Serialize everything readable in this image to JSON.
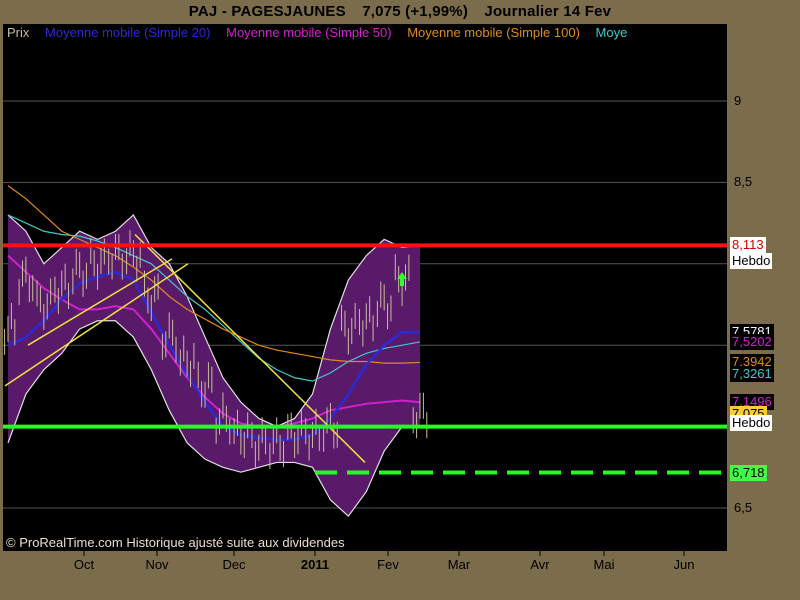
{
  "title": {
    "symbol": "PAJ - PAGESJAUNES",
    "price": "7,075 (+1,99%)",
    "period": "Journalier  14 Fev"
  },
  "legend": [
    {
      "label": "Prix",
      "color": "#c9bda0"
    },
    {
      "label": "Moyenne mobile (Simple 20)",
      "color": "#2a2ad8"
    },
    {
      "label": "Moyenne mobile (Simple 50)",
      "color": "#d020d0"
    },
    {
      "label": "Moyenne mobile (Simple 100)",
      "color": "#e08a20"
    },
    {
      "label": "Moye",
      "color": "#40c8c8"
    }
  ],
  "footer": "© ProRealTime.com Historique ajusté suite aux dividendes",
  "price_tags": [
    {
      "text": "8,113",
      "sub": "Hebdo",
      "bg": "#ffffff",
      "fg": "#d00000",
      "value": 8.113
    },
    {
      "text": "7,5781",
      "bg": "#000000",
      "fg": "#ffffff",
      "value": 7.5781
    },
    {
      "text": "7,5202",
      "bg": "#000000",
      "fg": "#d020d0",
      "value": 7.5202,
      "partial": true
    },
    {
      "text": "7,3942",
      "bg": "#000000",
      "fg": "#e08a20",
      "value": 7.3942,
      "partial": true
    },
    {
      "text": "7,3261",
      "bg": "#000000",
      "fg": "#40c8c8",
      "value": 7.3261
    },
    {
      "text": "7,1496",
      "bg": "#000000",
      "fg": "#d020d0",
      "value": 7.1496,
      "partial": true
    },
    {
      "text": "7,075",
      "bg": "#ffcc33",
      "fg": "#000000",
      "value": 7.075
    },
    {
      "text": "Hebdo",
      "bg": "#ffffff",
      "fg": "#000000",
      "value": 7.02
    },
    {
      "text": "6,718",
      "bg": "#40ff40",
      "fg": "#000000",
      "value": 6.718
    }
  ],
  "chart_data": {
    "type": "line",
    "title": "PAJ - PAGESJAUNES",
    "y_axis": {
      "ticks": [
        "9",
        "8,5",
        "8",
        "7,5",
        "7",
        "6,5"
      ],
      "range": [
        6.25,
        9.45
      ]
    },
    "x_axis": {
      "ticks": [
        "Oct",
        "Nov",
        "Dec",
        "2011",
        "Fev",
        "Mar",
        "Avr",
        "Mai",
        "Jun"
      ]
    },
    "horizontal_lines": [
      {
        "name": "resistance",
        "value": 8.113,
        "color": "#ff1010",
        "style": "solid"
      },
      {
        "name": "support",
        "value": 7.0,
        "color": "#20ff20",
        "style": "solid"
      },
      {
        "name": "support-dashed",
        "value": 6.718,
        "color": "#20ff20",
        "style": "dashed"
      }
    ],
    "series": [
      {
        "name": "Prix",
        "color": "#c9bda0",
        "x": [
          "Sep 9",
          "Sep 16",
          "Sep 23",
          "Sep 30",
          "Oct 7",
          "Oct 14",
          "Oct 21",
          "Oct 28",
          "Nov 4",
          "Nov 11",
          "Nov 18",
          "Nov 25",
          "Dec 2",
          "Dec 9",
          "Dec 16",
          "Dec 23",
          "Dec 30",
          "Jan 6",
          "Jan 13",
          "Jan 20",
          "Jan 27",
          "Feb 3",
          "Feb 10",
          "Feb 14"
        ],
        "y": [
          7.6,
          7.9,
          7.75,
          7.85,
          7.95,
          8.0,
          8.05,
          8.05,
          7.8,
          7.55,
          7.4,
          7.25,
          7.05,
          6.95,
          6.9,
          6.9,
          6.95,
          6.95,
          7.0,
          7.6,
          7.65,
          7.75,
          7.9,
          7.075
        ]
      },
      {
        "name": "Moyenne mobile (Simple 20)",
        "color": "#2a2ad8",
        "y": [
          7.5,
          7.55,
          7.65,
          7.78,
          7.88,
          7.92,
          7.95,
          7.9,
          7.7,
          7.5,
          7.32,
          7.15,
          7.0,
          6.95,
          6.93,
          6.92,
          6.92,
          6.95,
          7.05,
          7.2,
          7.38,
          7.5,
          7.58,
          7.5781
        ]
      },
      {
        "name": "Moyenne mobile (Simple 50)",
        "color": "#d020d0",
        "y": [
          8.05,
          7.95,
          7.85,
          7.78,
          7.72,
          7.72,
          7.74,
          7.72,
          7.6,
          7.45,
          7.3,
          7.18,
          7.08,
          7.02,
          7.0,
          7.0,
          7.02,
          7.05,
          7.1,
          7.12,
          7.14,
          7.15,
          7.16,
          7.1496
        ]
      },
      {
        "name": "Moyenne mobile (Simple 100)",
        "color": "#e08a20",
        "y": [
          8.48,
          8.4,
          8.3,
          8.2,
          8.15,
          8.1,
          8.05,
          7.98,
          7.9,
          7.8,
          7.72,
          7.66,
          7.6,
          7.55,
          7.5,
          7.47,
          7.45,
          7.43,
          7.41,
          7.4,
          7.4,
          7.39,
          7.39,
          7.3942
        ]
      },
      {
        "name": "Moye",
        "color": "#40c8c8",
        "y": [
          8.3,
          8.25,
          8.2,
          8.18,
          8.17,
          8.14,
          8.1,
          8.05,
          8.0,
          7.9,
          7.8,
          7.72,
          7.62,
          7.52,
          7.42,
          7.35,
          7.3,
          7.28,
          7.33,
          7.4,
          7.45,
          7.48,
          7.5,
          7.5202
        ]
      },
      {
        "name": "Bollinger",
        "color": "#5a1a6a",
        "upper": [
          8.3,
          8.2,
          8.0,
          8.1,
          8.2,
          8.15,
          8.2,
          8.3,
          8.1,
          8.0,
          7.8,
          7.55,
          7.3,
          7.15,
          7.05,
          7.0,
          7.05,
          7.2,
          7.6,
          7.9,
          8.05,
          8.15,
          8.1,
          8.113
        ],
        "lower": [
          6.9,
          7.2,
          7.35,
          7.45,
          7.6,
          7.65,
          7.65,
          7.55,
          7.35,
          7.1,
          6.9,
          6.8,
          6.75,
          6.72,
          6.75,
          6.78,
          6.78,
          6.75,
          6.55,
          6.45,
          6.6,
          6.85,
          7.0,
          7.0
        ]
      }
    ]
  }
}
